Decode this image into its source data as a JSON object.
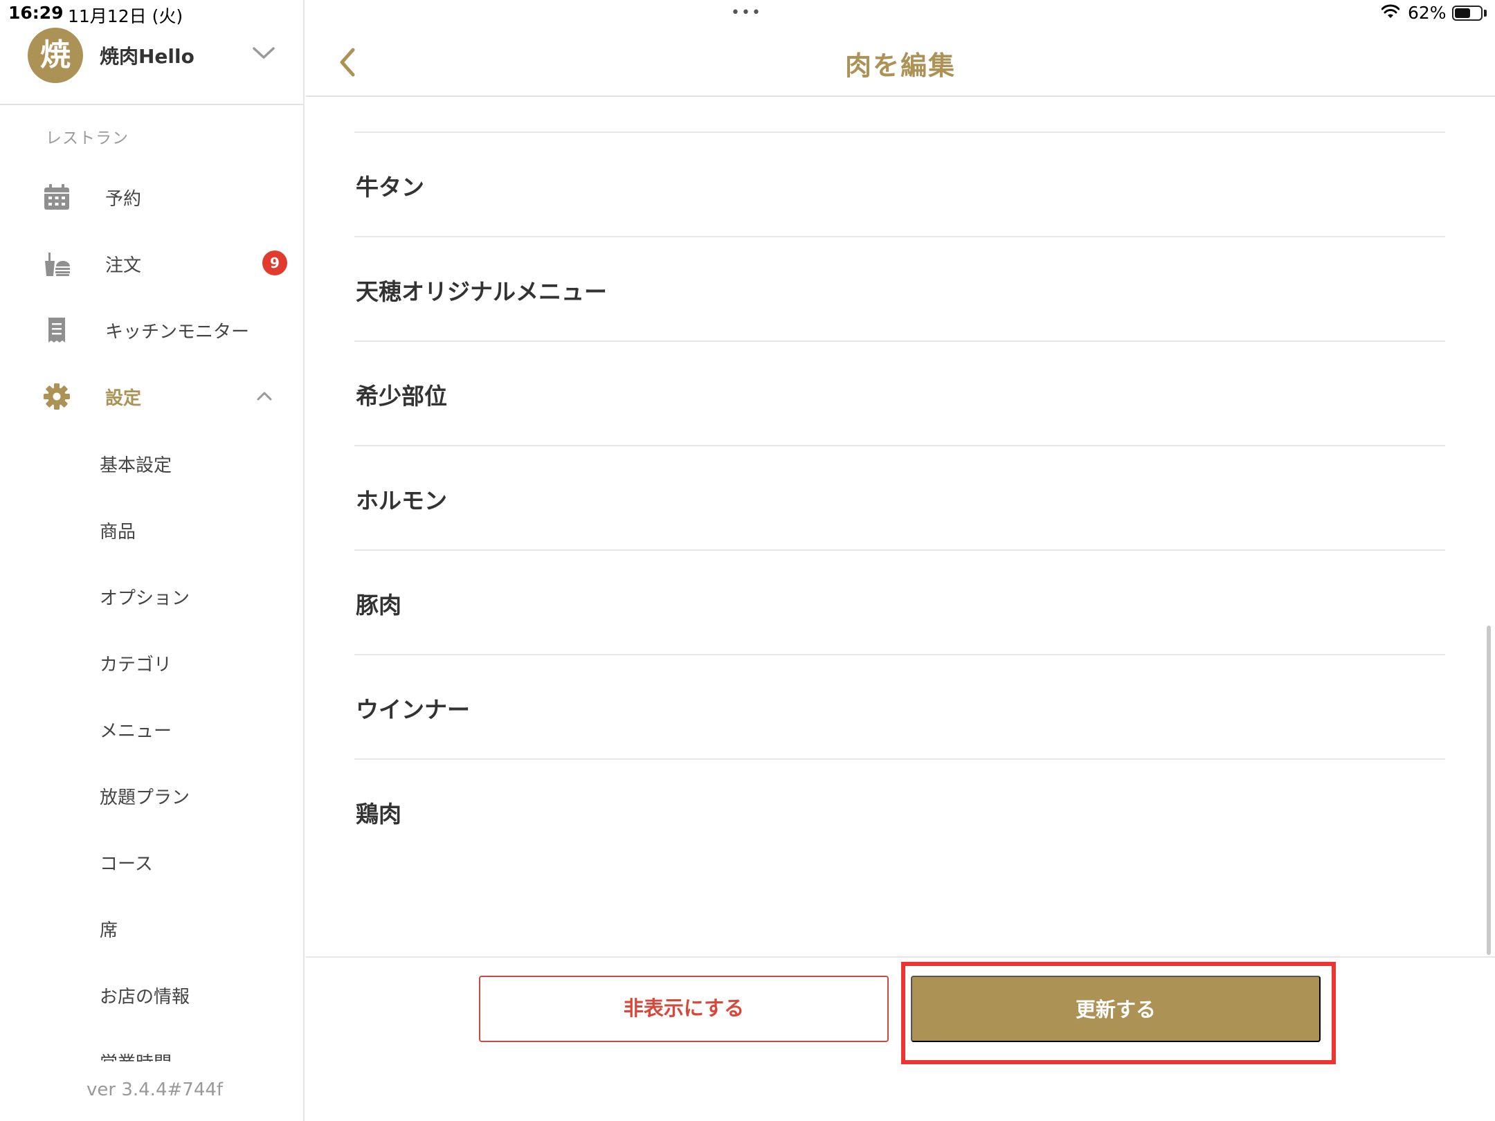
{
  "status_bar": {
    "time": "16:29",
    "date": "11月12日 (火)",
    "battery": "62%",
    "battery_level": 0.62,
    "multitask_dots": "•••"
  },
  "sidebar": {
    "avatar_text": "焼",
    "store_name": "焼肉Hello",
    "section_label": "レストラン",
    "nav": [
      {
        "label": "予約",
        "icon": "calendar-icon"
      },
      {
        "label": "注文",
        "icon": "food-order-icon",
        "badge": "9"
      },
      {
        "label": "キッチンモニター",
        "icon": "receipt-icon"
      },
      {
        "label": "設定",
        "icon": "gear-icon",
        "active": true
      }
    ],
    "settings_items": [
      "基本設定",
      "商品",
      "オプション",
      "カテゴリ",
      "メニュー",
      "放題プラン",
      "コース",
      "席",
      "お店の情報",
      "営業時間"
    ],
    "version": "ver 3.4.4#744f"
  },
  "main": {
    "title": "肉を編集",
    "list_items": [
      "牛タン",
      "天穂オリジナルメニュー",
      "希少部位",
      "ホルモン",
      "豚肉",
      "ウインナー",
      "鶏肉"
    ],
    "hide_button": "非表示にする",
    "update_button": "更新する"
  },
  "colors": {
    "accent": "#ad9255",
    "danger": "#d9473b",
    "highlight": "#ee3333",
    "badge": "#e23b2e"
  }
}
